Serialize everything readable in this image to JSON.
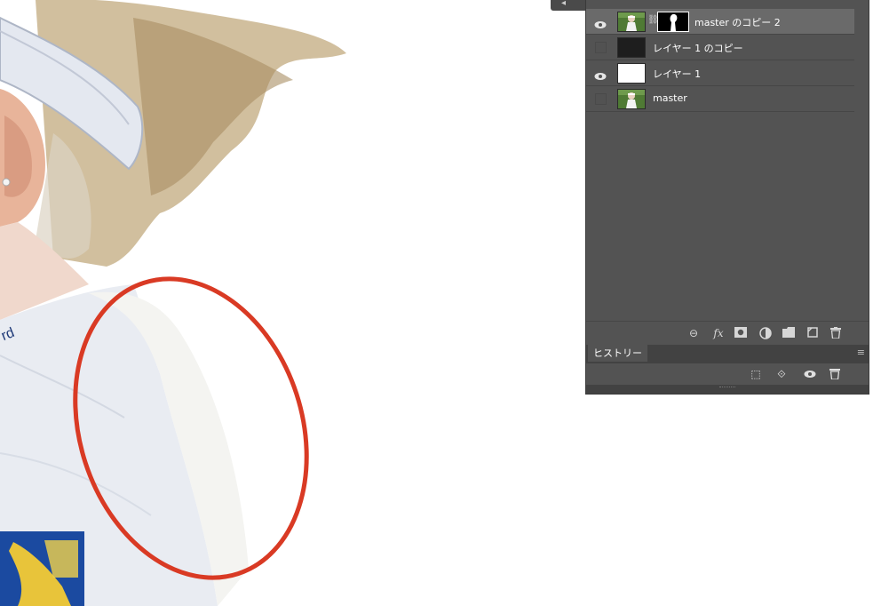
{
  "layers_panel": {
    "layers": [
      {
        "name": "master のコピー 2",
        "visible": true,
        "selected": true,
        "has_mask": true,
        "thumb": "photo"
      },
      {
        "name": "レイヤー 1 のコピー",
        "visible": false,
        "selected": false,
        "has_mask": false,
        "thumb": "dark"
      },
      {
        "name": "レイヤー 1",
        "visible": true,
        "selected": false,
        "has_mask": false,
        "thumb": "white"
      },
      {
        "name": "master",
        "visible": false,
        "selected": false,
        "has_mask": false,
        "thumb": "photo"
      }
    ],
    "footer_icons": [
      "link-layers-icon",
      "fx-icon",
      "add-mask-icon",
      "adjustment-layer-icon",
      "new-group-icon",
      "new-layer-icon",
      "delete-layer-icon"
    ]
  },
  "history_panel": {
    "tab_label": "ヒストリー",
    "icons": [
      "new-document-from-state-icon",
      "new-snapshot-icon",
      "visibility-icon",
      "delete-state-icon"
    ]
  },
  "canvas": {
    "annotation_color": "#d93a24",
    "logo_text": "rd"
  }
}
